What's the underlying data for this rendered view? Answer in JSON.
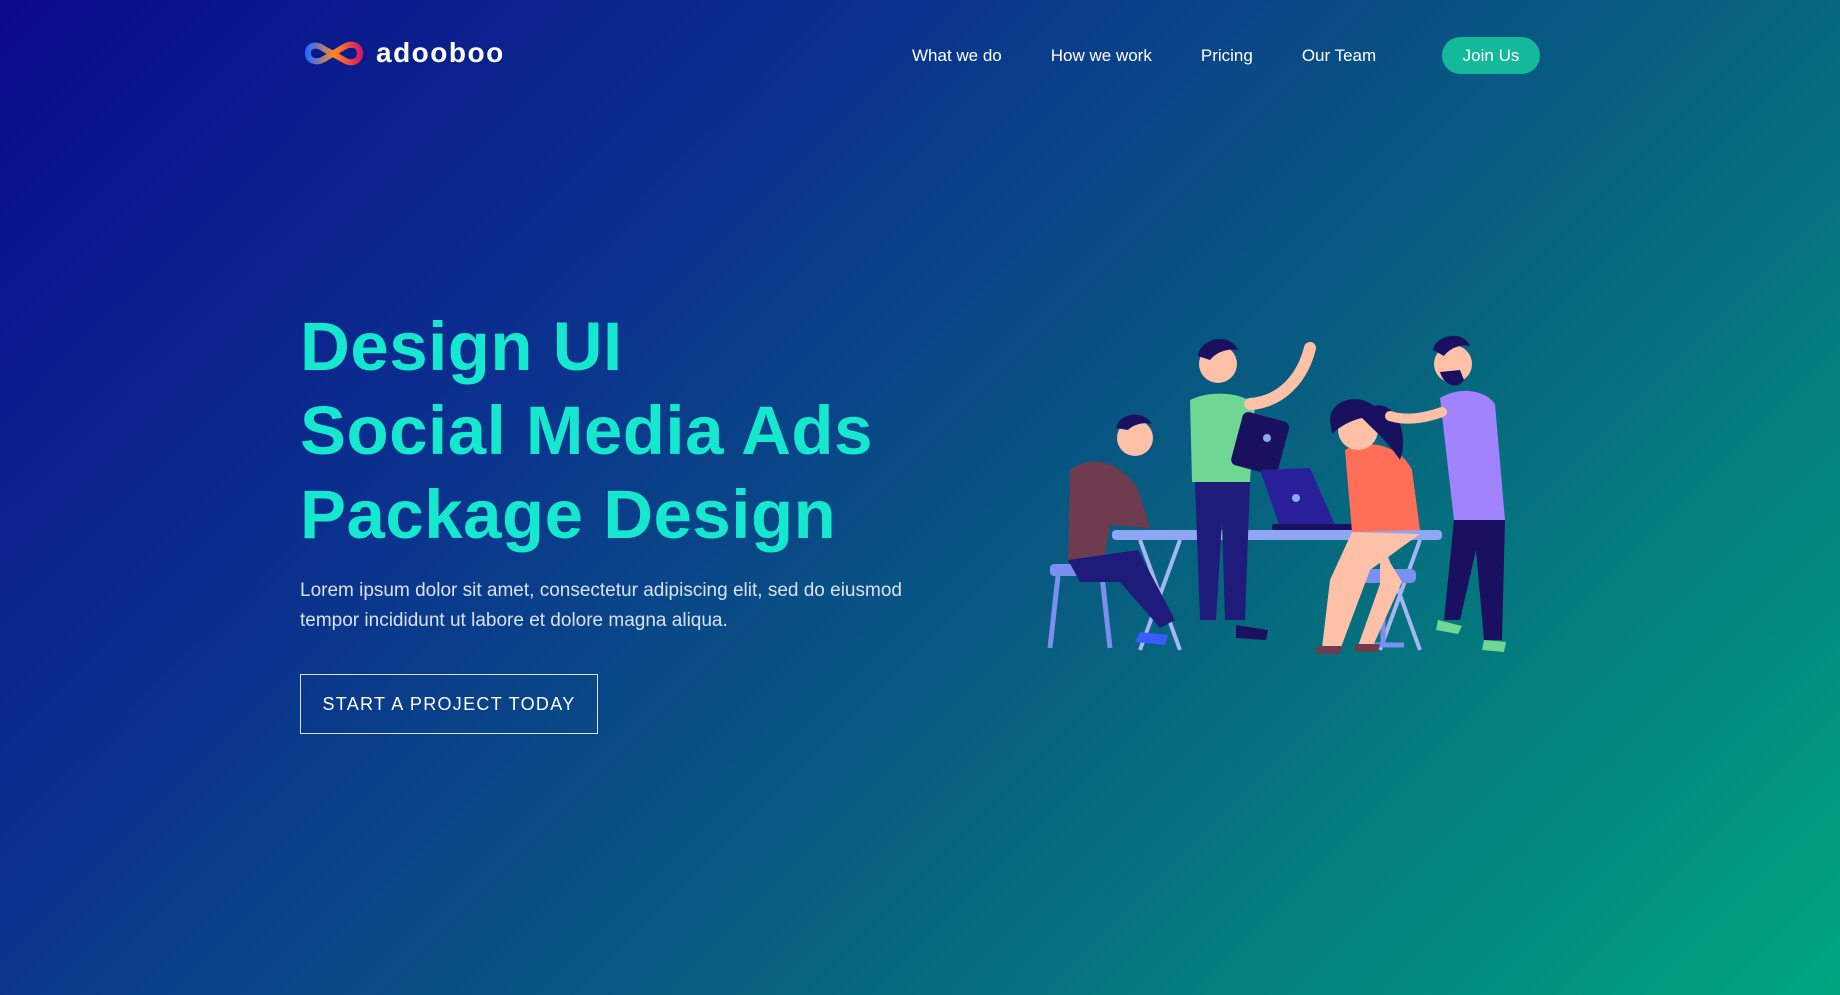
{
  "brand": {
    "name": "adooboo",
    "logo_icon": "infinity-logo-icon"
  },
  "nav": {
    "links": [
      "What we do",
      "How we work",
      "Pricing",
      "Our Team"
    ],
    "cta": "Join Us"
  },
  "hero": {
    "lines": [
      "Design UI",
      "Social Media Ads",
      "Package Design"
    ],
    "description": "Lorem ipsum dolor sit amet, consectetur adipiscing elit, sed do eiusmod tempor incididunt ut labore et dolore magna aliqua.",
    "button": "START A PROJECT TODAY"
  },
  "illustration": {
    "icon": "team-working-illustration"
  },
  "colors": {
    "accent": "#16e8cf",
    "join_button": "#13b99a",
    "gradient_start": "#0a0a8c",
    "gradient_end": "#00a57f"
  }
}
